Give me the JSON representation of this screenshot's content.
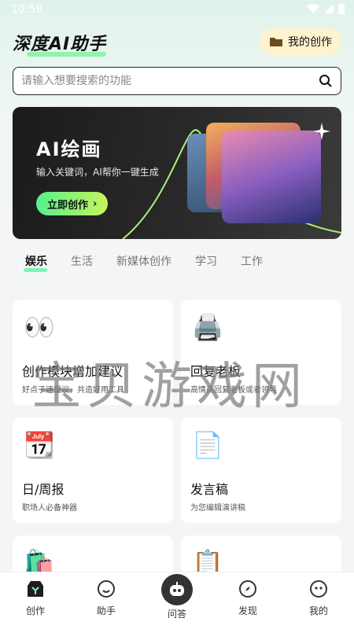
{
  "status": {
    "time": "10:58"
  },
  "header": {
    "app_title": "深度AI助手",
    "my_creation": "我的创作"
  },
  "search": {
    "placeholder": "请输入想要搜索的功能"
  },
  "banner": {
    "title": "AI绘画",
    "subtitle": "输入关键词，AI帮你一键生成",
    "cta": "立即创作"
  },
  "categories": [
    "娱乐",
    "生活",
    "新媒体创作",
    "学习",
    "工作"
  ],
  "tiles": [
    {
      "icon": "eyes-icon",
      "title": "创作模块增加建议",
      "desc": "好点子速提议，共造好用工具"
    },
    {
      "icon": "printer-icon",
      "title": "回复老板",
      "desc": "高情商回复老板或者领导"
    },
    {
      "icon": "calendar-icon",
      "title": "日/周报",
      "desc": "职场人必备神器"
    },
    {
      "icon": "document-icon",
      "title": "发言稿",
      "desc": "为您编辑演讲稿"
    },
    {
      "icon": "shopping-bag-icon",
      "title": "",
      "desc": ""
    },
    {
      "icon": "clipboard-icon",
      "title": "",
      "desc": ""
    }
  ],
  "watermark": "宝贝游戏网",
  "tabbar": [
    {
      "label": "创作",
      "icon": "create-icon"
    },
    {
      "label": "助手",
      "icon": "smile-icon"
    },
    {
      "label": "问答",
      "icon": "robot-icon"
    },
    {
      "label": "发现",
      "icon": "compass-icon"
    },
    {
      "label": "我的",
      "icon": "profile-icon"
    }
  ]
}
